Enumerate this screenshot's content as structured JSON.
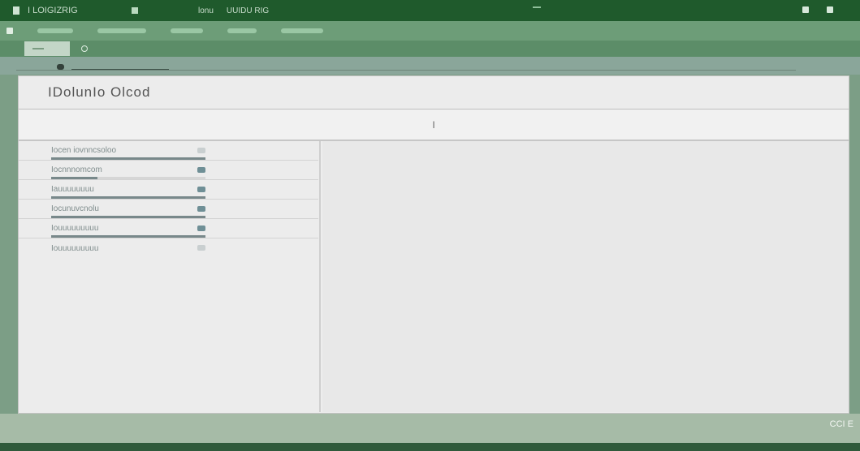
{
  "titlebar": {
    "app_name": "I LOIGIZRIG",
    "menu": [
      "lonu",
      "UUIDU RIG"
    ]
  },
  "window": {
    "title": "IDolunIo Olcod",
    "subheader_text": "I"
  },
  "sidebar": {
    "items": [
      {
        "label": "Iocen iovnncsoloo",
        "progress": 1.0,
        "status": "neutral"
      },
      {
        "label": "Iocnnnomcom",
        "progress": 0.3,
        "status": "active"
      },
      {
        "label": "Iauuuuuuuu",
        "progress": 1.0,
        "status": "active"
      },
      {
        "label": "Iocunuvcnolu",
        "progress": 1.0,
        "status": "active"
      },
      {
        "label": "Iouuuuuuuuu",
        "progress": 1.0,
        "status": "active"
      },
      {
        "label": "Iouuuuuuuuu",
        "progress": null,
        "status": "muted"
      }
    ]
  },
  "status": {
    "text": "CCI E"
  },
  "colors": {
    "titlebar": "#1f5a2c",
    "toolbar": "#6d9d78",
    "status_icon": "#6f8f96"
  }
}
